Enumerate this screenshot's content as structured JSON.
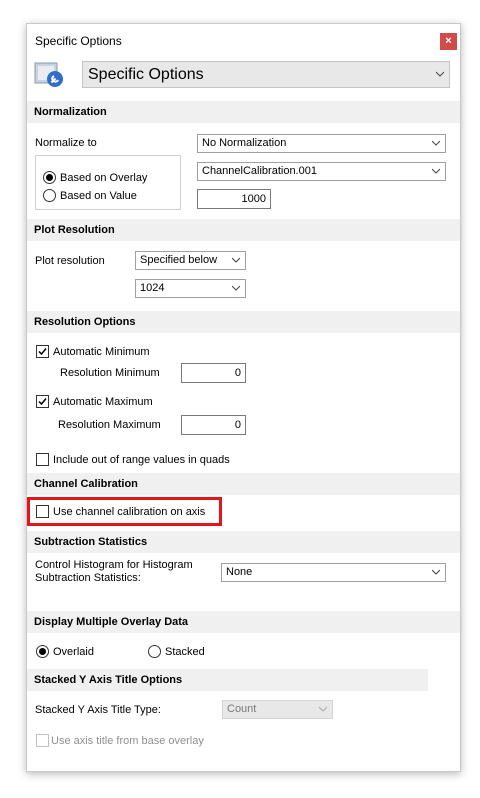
{
  "window": {
    "title": "Specific Options",
    "close_glyph": "×",
    "header_select_value": "Specific Options"
  },
  "normalization": {
    "header": "Normalization",
    "normalize_to_label": "Normalize to",
    "normalize_to_value": "No Normalization",
    "based_on_overlay_label": "Based on Overlay",
    "based_on_value_label": "Based on Value",
    "overlay_select_value": "ChannelCalibration.001",
    "value_input": "1000"
  },
  "plot_resolution": {
    "header": "Plot Resolution",
    "label": "Plot resolution",
    "mode_value": "Specified below",
    "resolution_value": "1024"
  },
  "resolution_options": {
    "header": "Resolution Options",
    "auto_min_label": "Automatic Minimum",
    "res_min_label": "Resolution Minimum",
    "res_min_value": "0",
    "auto_max_label": "Automatic Maximum",
    "res_max_label": "Resolution Maximum",
    "res_max_value": "0",
    "include_out_of_range_label": "Include out of range values in quads"
  },
  "channel_calibration": {
    "header": "Channel Calibration",
    "use_channel_cal_label": "Use channel calibration on axis"
  },
  "subtraction_statistics": {
    "header": "Subtraction Statistics",
    "control_label_line1": "Control Histogram for Histogram",
    "control_label_line2": "Subtraction Statistics:",
    "control_value": "None"
  },
  "display_overlay": {
    "header": "Display Multiple Overlay Data",
    "overlaid_label": "Overlaid",
    "stacked_label": "Stacked"
  },
  "stacked_y_axis": {
    "header": "Stacked Y Axis Title Options",
    "type_label": "Stacked Y Axis Title Type:",
    "type_value": "Count",
    "use_base_label": "Use axis title from base overlay"
  },
  "colors": {
    "highlight": "#e3151a",
    "close_button": "#d24b4b",
    "section_bg": "#f0f0f0"
  }
}
